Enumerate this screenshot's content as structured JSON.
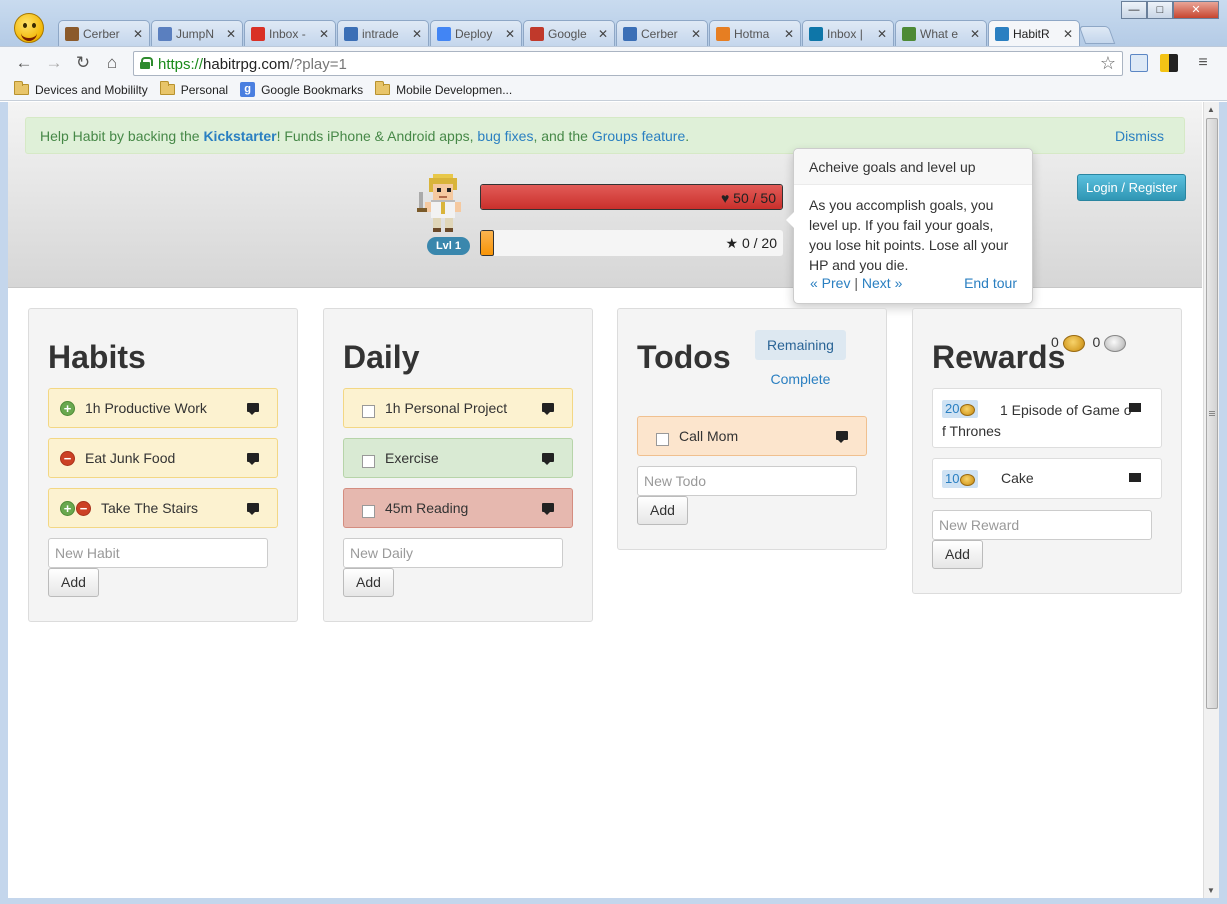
{
  "browser": {
    "tabs": [
      {
        "title": "Cerber",
        "icon_color": "#8b5a2b",
        "icon": "animal-icon"
      },
      {
        "title": "JumpN",
        "icon_color": "#5a7fbf",
        "icon": "jump-icon"
      },
      {
        "title": "Inbox -",
        "icon_color": "#d93025",
        "icon": "gmail-icon"
      },
      {
        "title": "intrade",
        "icon_color": "#3b6fb6",
        "icon": "doc-icon"
      },
      {
        "title": "Deploy",
        "icon_color": "#4285f4",
        "icon": "google-cloud-icon"
      },
      {
        "title": "Google",
        "icon_color": "#c0392b",
        "icon": "zd-icon"
      },
      {
        "title": "Cerber",
        "icon_color": "#3b6fb6",
        "icon": "doc-icon"
      },
      {
        "title": "Hotma",
        "icon_color": "#e67e22",
        "icon": "hotmail-icon"
      },
      {
        "title": "Inbox |",
        "icon_color": "#0e76a8",
        "icon": "linkedin-icon"
      },
      {
        "title": "What e",
        "icon_color": "#4e8a35",
        "icon": "globe-icon"
      },
      {
        "title": "HabitR",
        "icon_color": "#2a7fc1",
        "icon": "habit-icon"
      }
    ],
    "close_glyph": "✕",
    "url": {
      "scheme": "https://",
      "host": "habitrpg.com",
      "path": "/?play=1"
    },
    "bookmarks": [
      "Devices and Mobililty",
      "Personal",
      "Google Bookmarks",
      "Mobile Developmen..."
    ],
    "window_buttons": {
      "minimize": "—",
      "maximize": "□",
      "close": "✕"
    }
  },
  "banner": {
    "prefix": "Help Habit by backing the ",
    "kickstarter": "Kickstarter",
    "middle": "! Funds iPhone & Android apps, ",
    "bug_fixes": "bug fixes",
    "and": ", and the ",
    "groups": "Groups feature",
    "suffix": ".",
    "dismiss": "Dismiss"
  },
  "player": {
    "level": "Lvl 1",
    "hp_text": "50 / 50",
    "hp_fraction": 1.0,
    "xp_text": "0 / 20",
    "xp_fraction": 0.0
  },
  "tour": {
    "title": "Acheive goals and level up",
    "body": "As you accomplish goals, you level up. If you fail your goals, you lose hit points. Lose all your HP and you die.",
    "prev": "« Prev",
    "sep": "|",
    "next": "Next »",
    "end": "End tour"
  },
  "login_label": "Login / Register",
  "habits": {
    "title": "Habits",
    "items": [
      {
        "label": "1h Productive Work"
      },
      {
        "label": "Eat Junk Food"
      },
      {
        "label": "Take The Stairs"
      }
    ],
    "placeholder": "New Habit",
    "add": "Add"
  },
  "daily": {
    "title": "Daily",
    "items": [
      {
        "label": "1h Personal Project"
      },
      {
        "label": "Exercise"
      },
      {
        "label": "45m Reading"
      }
    ],
    "placeholder": "New Daily",
    "add": "Add"
  },
  "todos": {
    "title": "Todos",
    "filter_remaining": "Remaining",
    "filter_complete": "Complete",
    "items": [
      {
        "label": "Call Mom"
      }
    ],
    "placeholder": "New Todo",
    "add": "Add"
  },
  "rewards": {
    "title": "Rewards",
    "gold": "0",
    "silver": "0",
    "items": [
      {
        "price": "20",
        "label": "1 Episode of Game of Thrones"
      },
      {
        "price": "10",
        "label": "Cake"
      }
    ],
    "placeholder": "New Reward",
    "add": "Add"
  },
  "colors": {
    "habit_yellow": "#fcf2d0",
    "daily_green": "#d9ead3",
    "daily_red": "#e6b8af",
    "todo_orange": "#fce5cd",
    "link_blue": "#2a7fc1",
    "hp_red": "#c9302c",
    "xp_orange": "#f89406",
    "login_blue": "#2f96b4"
  }
}
